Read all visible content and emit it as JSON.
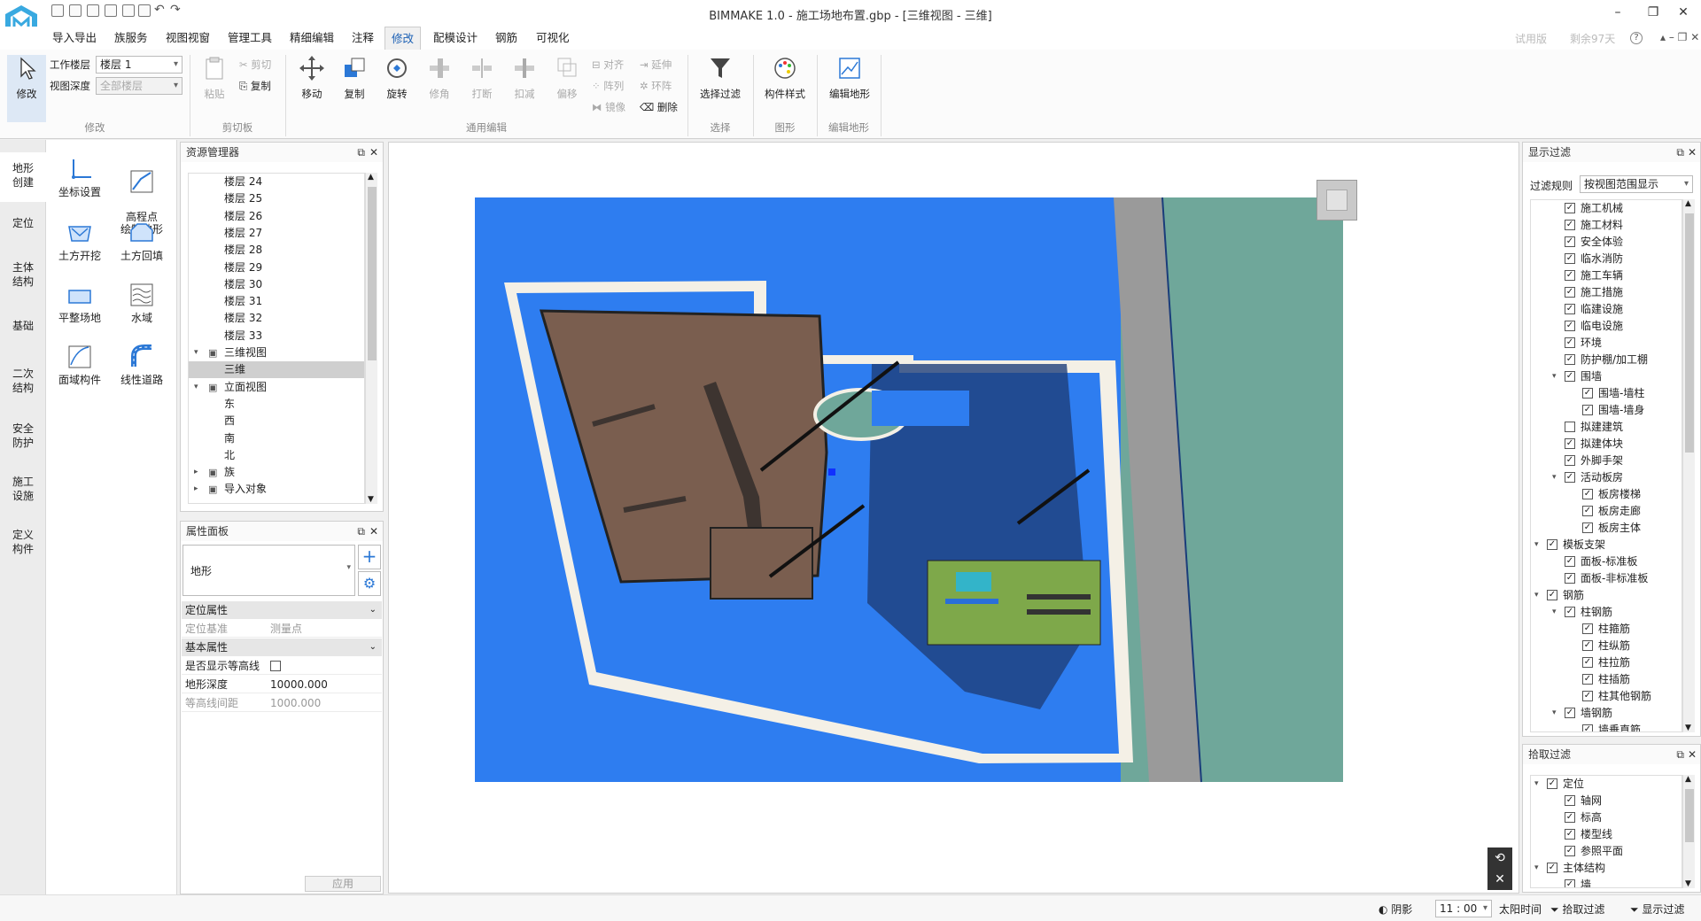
{
  "app": {
    "title": "BIMMAKE 1.0 - 施工场地布置.gbp - [三维视图 - 三维]"
  },
  "window_controls": {
    "minimize": "–",
    "restore": "❐",
    "close": "✕"
  },
  "menubar": {
    "items": [
      "导入导出",
      "族服务",
      "视图视窗",
      "管理工具",
      "精细编辑",
      "注释",
      "修改",
      "配模设计",
      "钢筋",
      "可视化"
    ],
    "active": "修改",
    "right": {
      "trial": "试用版",
      "days_left": "剩余97天",
      "help": "?"
    }
  },
  "ribbon": {
    "modify": {
      "label": "修改",
      "work_floor_label": "工作楼层",
      "work_floor_value": "楼层 1",
      "view_depth_label": "视图深度",
      "view_depth_value": "全部楼层",
      "group": "修改"
    },
    "clipboard": {
      "paste": "粘贴",
      "cut": "剪切",
      "copy": "复制",
      "group": "剪切板"
    },
    "edit": {
      "move": "移动",
      "copy": "复制",
      "rotate": "旋转",
      "trim": "修角",
      "break": "打断",
      "deduct": "扣减",
      "offset": "偏移",
      "align": "对齐",
      "array": "阵列",
      "mirror": "镜像",
      "extend": "延伸",
      "ring": "环阵",
      "delete": "删除",
      "group": "通用编辑"
    },
    "select": {
      "filter": "选择过滤",
      "group": "选择"
    },
    "graphics": {
      "style": "构件样式",
      "group": "图形"
    },
    "terrain": {
      "edit": "编辑地形",
      "group": "编辑地形"
    }
  },
  "left_tabs": [
    "地形\n创建",
    "定位",
    "主体\n结构",
    "基础",
    "二次\n结构",
    "安全\n防护",
    "施工\n设施",
    "定义\n构件"
  ],
  "left_tab_active": 0,
  "tools": [
    {
      "label": "坐标设置",
      "icon": "coordinate-icon"
    },
    {
      "label": "高程点\n绘制地形",
      "icon": "elevation-point-icon"
    },
    {
      "label": "土方开挖",
      "icon": "excavation-icon"
    },
    {
      "label": "土方回填",
      "icon": "backfill-icon"
    },
    {
      "label": "平整场地",
      "icon": "level-site-icon"
    },
    {
      "label": "水域",
      "icon": "water-icon"
    },
    {
      "label": "面域构件",
      "icon": "area-component-icon"
    },
    {
      "label": "线性道路",
      "icon": "road-icon"
    }
  ],
  "resource_manager": {
    "title": "资源管理器",
    "rows": [
      {
        "text": "楼层 24",
        "level": 2
      },
      {
        "text": "楼层 25",
        "level": 2
      },
      {
        "text": "楼层 26",
        "level": 2
      },
      {
        "text": "楼层 27",
        "level": 2
      },
      {
        "text": "楼层 28",
        "level": 2
      },
      {
        "text": "楼层 29",
        "level": 2
      },
      {
        "text": "楼层 30",
        "level": 2
      },
      {
        "text": "楼层 31",
        "level": 2
      },
      {
        "text": "楼层 32",
        "level": 2
      },
      {
        "text": "楼层 33",
        "level": 2
      },
      {
        "text": "三维视图",
        "level": 1,
        "expander": "open"
      },
      {
        "text": "三维",
        "level": 2,
        "selected": true
      },
      {
        "text": "立面视图",
        "level": 1,
        "expander": "open"
      },
      {
        "text": "东",
        "level": 2
      },
      {
        "text": "西",
        "level": 2
      },
      {
        "text": "南",
        "level": 2
      },
      {
        "text": "北",
        "level": 2
      },
      {
        "text": "族",
        "level": 1,
        "expander": "closed"
      },
      {
        "text": "导入对象",
        "level": 1,
        "expander": "closed"
      }
    ]
  },
  "property_panel": {
    "title": "属性面板",
    "type": "地形",
    "sections": [
      {
        "title": "定位属性",
        "rows": [
          {
            "key": "定位基准",
            "value": "测量点",
            "disabled": true
          }
        ]
      },
      {
        "title": "基本属性",
        "rows": [
          {
            "key": "是否显示等高线",
            "value": "",
            "checkbox": true
          },
          {
            "key": "地形深度",
            "value": "10000.000"
          },
          {
            "key": "等高线间距",
            "value": "1000.000",
            "disabled": true
          }
        ]
      }
    ],
    "apply": "应用"
  },
  "display_filter": {
    "title": "显示过滤",
    "rule_label": "过滤规则",
    "rule_value": "按视图范围显示",
    "items": [
      {
        "text": "施工机械",
        "level": 2,
        "checked": true
      },
      {
        "text": "施工材料",
        "level": 2,
        "checked": true
      },
      {
        "text": "安全体验",
        "level": 2,
        "checked": true
      },
      {
        "text": "临水消防",
        "level": 2,
        "checked": true
      },
      {
        "text": "施工车辆",
        "level": 2,
        "checked": true
      },
      {
        "text": "施工措施",
        "level": 2,
        "checked": true
      },
      {
        "text": "临建设施",
        "level": 2,
        "checked": true
      },
      {
        "text": "临电设施",
        "level": 2,
        "checked": true
      },
      {
        "text": "环境",
        "level": 2,
        "checked": true
      },
      {
        "text": "防护棚/加工棚",
        "level": 2,
        "checked": true
      },
      {
        "text": "围墙",
        "level": 2,
        "checked": true,
        "expander": "open"
      },
      {
        "text": "围墙-墙柱",
        "level": 3,
        "checked": true
      },
      {
        "text": "围墙-墙身",
        "level": 3,
        "checked": true
      },
      {
        "text": "拟建建筑",
        "level": 2,
        "checked": false
      },
      {
        "text": "拟建体块",
        "level": 2,
        "checked": true
      },
      {
        "text": "外脚手架",
        "level": 2,
        "checked": true
      },
      {
        "text": "活动板房",
        "level": 2,
        "checked": true,
        "expander": "open"
      },
      {
        "text": "板房楼梯",
        "level": 3,
        "checked": true
      },
      {
        "text": "板房走廊",
        "level": 3,
        "checked": true
      },
      {
        "text": "板房主体",
        "level": 3,
        "checked": true
      },
      {
        "text": "模板支架",
        "level": 1,
        "checked": true,
        "expander": "open"
      },
      {
        "text": "面板-标准板",
        "level": 2,
        "checked": true
      },
      {
        "text": "面板-非标准板",
        "level": 2,
        "checked": true
      },
      {
        "text": "钢筋",
        "level": 1,
        "checked": true,
        "expander": "open"
      },
      {
        "text": "柱钢筋",
        "level": 2,
        "checked": true,
        "expander": "open"
      },
      {
        "text": "柱箍筋",
        "level": 3,
        "checked": true
      },
      {
        "text": "柱纵筋",
        "level": 3,
        "checked": true
      },
      {
        "text": "柱拉筋",
        "level": 3,
        "checked": true
      },
      {
        "text": "柱插筋",
        "level": 3,
        "checked": true
      },
      {
        "text": "柱其他钢筋",
        "level": 3,
        "checked": true
      },
      {
        "text": "墙钢筋",
        "level": 2,
        "checked": true,
        "expander": "open"
      },
      {
        "text": "墙垂直筋",
        "level": 3,
        "checked": true
      }
    ]
  },
  "pick_filter": {
    "title": "拾取过滤",
    "items": [
      {
        "text": "定位",
        "level": 1,
        "checked": true,
        "expander": "open"
      },
      {
        "text": "轴网",
        "level": 2,
        "checked": true
      },
      {
        "text": "标高",
        "level": 2,
        "checked": true
      },
      {
        "text": "楼型线",
        "level": 2,
        "checked": true
      },
      {
        "text": "参照平面",
        "level": 2,
        "checked": true
      },
      {
        "text": "主体结构",
        "level": 1,
        "checked": true,
        "expander": "open"
      },
      {
        "text": "墙",
        "level": 2,
        "checked": true
      }
    ]
  },
  "statusbar": {
    "shadow": "阴影",
    "time_value": "11 : 00",
    "sun_time": "太阳时间",
    "pick_filter": "拾取过滤",
    "display_filter": "显示过滤"
  },
  "colors": {
    "accent": "#1a5fb4",
    "water": "#2e7df0",
    "grass": "#6fa79a",
    "road": "#9a9a9a",
    "pit": "#7a5e4f"
  }
}
